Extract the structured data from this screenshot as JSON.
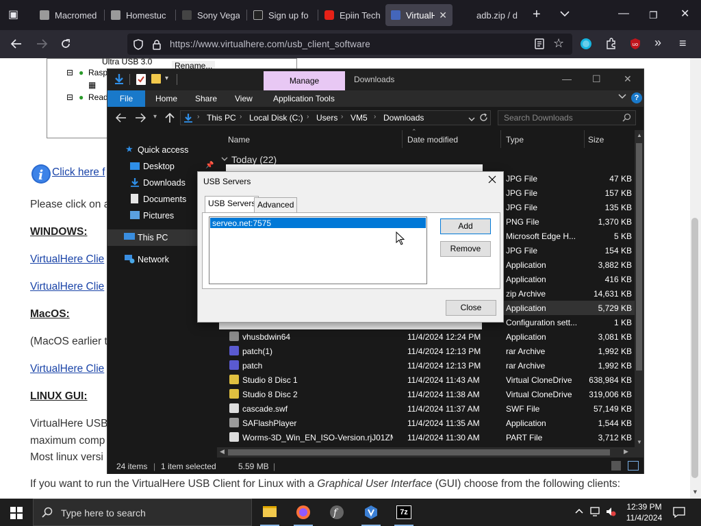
{
  "browser": {
    "tabs": [
      {
        "title": "Macromed",
        "color": "#9a9a9a"
      },
      {
        "title": "Homestuc",
        "color": "#9a9a9a"
      },
      {
        "title": "Sony Vega",
        "color": "#444444"
      },
      {
        "title": "Sign up fo",
        "color": "#222222"
      },
      {
        "title": "Epiin Tech",
        "color": "#e62117"
      },
      {
        "title": "VirtualH",
        "color": "#4466bb"
      },
      {
        "title": "adb.zip / down",
        "color": "#333333"
      }
    ],
    "url": "https://www.virtualhere.com/usb_client_software"
  },
  "webpage": {
    "tree_items": [
      "Ultra USB 3.0",
      "Rasp",
      "Read",
      "Rename..."
    ],
    "click_here": "Click here f",
    "please_click": "Please click on a",
    "windows_head": "WINDOWS:",
    "link1": "VirtualHere Clie",
    "link2": "VirtualHere Clie",
    "macos_head": "MacOS:",
    "macos_text": "(MacOS earlier t",
    "link3": "VirtualHere Clie",
    "linux_head": "LINUX GUI:",
    "linux_p1": "VirtualHere USB",
    "linux_p2": "maximum comp",
    "linux_p3": "Most linux versi",
    "bottom_line_a": "If you want to run the VirtualHere USB Client for Linux with a ",
    "bottom_line_b": "Graphical User Interface",
    "bottom_line_c": " (GUI) choose from the following clients:"
  },
  "explorer": {
    "manage_tab": "Manage",
    "title": "Downloads",
    "ribbon": [
      "File",
      "Home",
      "Share",
      "View",
      "Application Tools"
    ],
    "breadcrumbs": [
      "This PC",
      "Local Disk (C:)",
      "Users",
      "VM5",
      "Downloads"
    ],
    "search_placeholder": "Search Downloads",
    "nav": [
      "Quick access",
      "Desktop",
      "Downloads",
      "Documents",
      "Pictures",
      "This PC",
      "Network"
    ],
    "columns": [
      "Name",
      "Date modified",
      "Type",
      "Size"
    ],
    "group": "Today (22)",
    "rows_hidden": [
      {
        "type": "JPG File",
        "size": "47 KB"
      },
      {
        "type": "JPG File",
        "size": "157 KB"
      },
      {
        "type": "JPG File",
        "size": "135 KB"
      },
      {
        "type": "PNG File",
        "size": "1,370 KB"
      },
      {
        "type": "Microsoft Edge H...",
        "size": "5 KB"
      },
      {
        "type": "JPG File",
        "size": "154 KB"
      },
      {
        "type": "Application",
        "size": "3,882 KB"
      },
      {
        "type": "Application",
        "size": "416 KB"
      },
      {
        "type": "zip Archive",
        "size": "14,631 KB"
      },
      {
        "type": "Application",
        "size": "5,729 KB"
      },
      {
        "type": "Configuration sett...",
        "size": "1 KB"
      }
    ],
    "rows": [
      {
        "name": "vhusbdwin64",
        "date": "11/4/2024 12:24 PM",
        "type": "Application",
        "size": "3,081 KB",
        "icon": "#8a8a8a"
      },
      {
        "name": "patch(1)",
        "date": "11/4/2024 12:13 PM",
        "type": "rar Archive",
        "size": "1,992 KB",
        "icon": "#5a5ad0"
      },
      {
        "name": "patch",
        "date": "11/4/2024 12:13 PM",
        "type": "rar Archive",
        "size": "1,992 KB",
        "icon": "#5a5ad0"
      },
      {
        "name": "Studio 8 Disc 1",
        "date": "11/4/2024 11:43 AM",
        "type": "Virtual CloneDrive",
        "size": "638,984 KB",
        "icon": "#e0c040"
      },
      {
        "name": "Studio 8 Disc 2",
        "date": "11/4/2024 11:38 AM",
        "type": "Virtual CloneDrive",
        "size": "319,006 KB",
        "icon": "#e0c040"
      },
      {
        "name": "cascade.swf",
        "date": "11/4/2024 11:37 AM",
        "type": "SWF File",
        "size": "57,149 KB",
        "icon": "#dddddd"
      },
      {
        "name": "SAFlashPlayer",
        "date": "11/4/2024 11:35 AM",
        "type": "Application",
        "size": "1,544 KB",
        "icon": "#9a9a9a"
      },
      {
        "name": "Worms-3D_Win_EN_ISO-Version.rjJ01ZM...",
        "date": "11/4/2024 11:30 AM",
        "type": "PART File",
        "size": "3,712 KB",
        "icon": "#dddddd"
      }
    ],
    "status": {
      "items": "24 items",
      "selected": "1 item selected",
      "size": "5.59 MB"
    }
  },
  "dialog": {
    "title": "USB Servers",
    "tabs": [
      "USB Servers",
      "Advanced"
    ],
    "list_item": "serveo.net:7575",
    "add": "Add",
    "remove": "Remove",
    "close": "Close"
  },
  "taskbar": {
    "search_placeholder": "Type here to search",
    "time": "12:39 PM",
    "date": "11/4/2024"
  }
}
